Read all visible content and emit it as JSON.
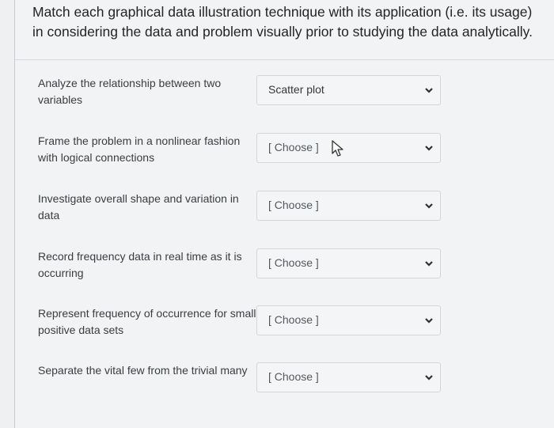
{
  "question": {
    "text": "Match each graphical data illustration technique with its application (i.e. its usage) in considering the data and problem visually prior to studying the data analytically."
  },
  "rows": [
    {
      "label": "Analyze the relationship between two variables",
      "selected": "Scatter plot"
    },
    {
      "label": "Frame the problem in a nonlinear fashion with logical connections",
      "selected": "[ Choose ]"
    },
    {
      "label": "Investigate overall shape and variation in data",
      "selected": "[ Choose ]"
    },
    {
      "label": "Record frequency data in real time as it is occurring",
      "selected": "[ Choose ]"
    },
    {
      "label": "Represent frequency of occurrence for small positive data sets",
      "selected": "[ Choose ]"
    },
    {
      "label": "Separate the vital few from the trivial many",
      "selected": "[ Choose ]"
    }
  ],
  "icons": {
    "dropdown": "chevron-down-icon",
    "cursor": "mouse-pointer-icon"
  },
  "colors": {
    "background": "#f2f3f4",
    "text": "#222426",
    "chevron": "#2e3134"
  }
}
